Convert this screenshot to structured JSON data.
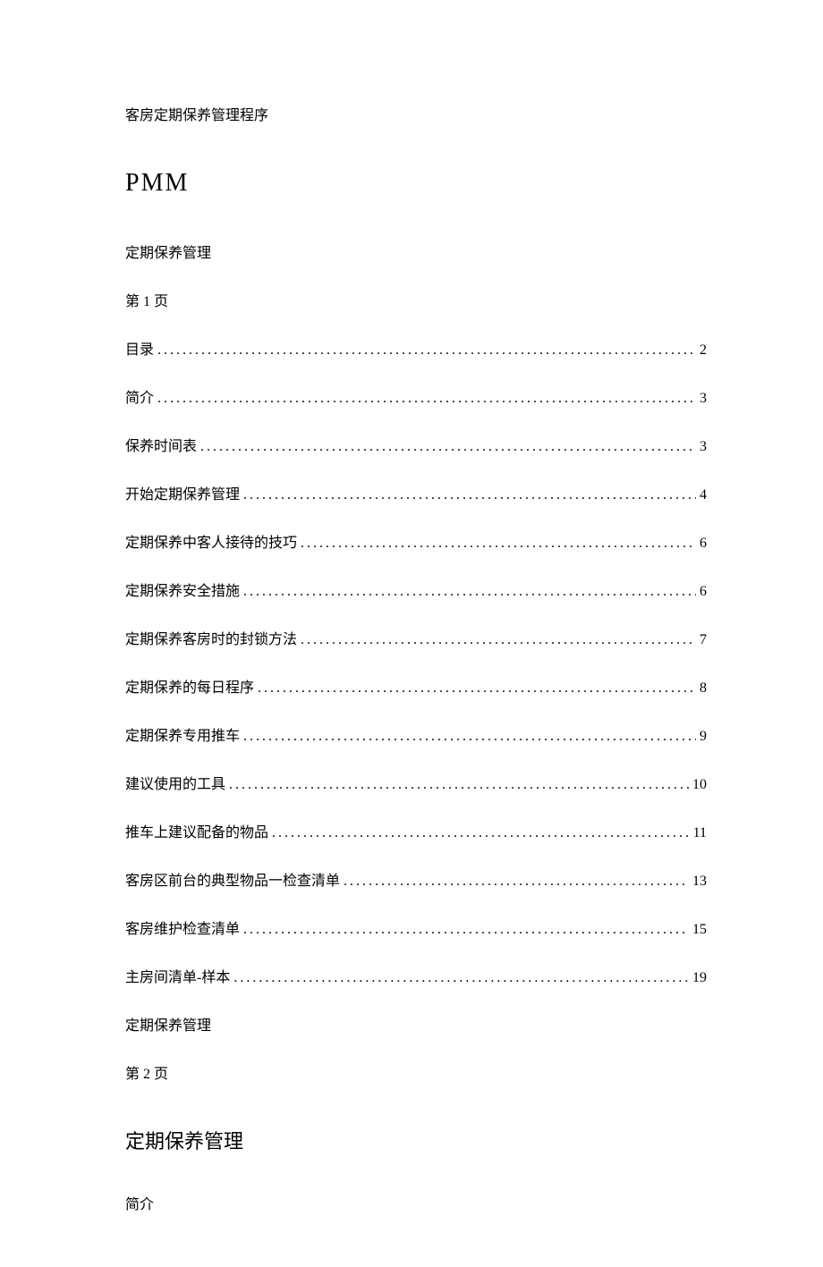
{
  "header": {
    "title": "客房定期保养管理程序"
  },
  "pmm": {
    "label": "PMM"
  },
  "section1": {
    "label": "定期保养管理",
    "pageLabel": "第 1 页"
  },
  "toc": {
    "items": [
      {
        "title": "目录",
        "page": "2"
      },
      {
        "title": "简介",
        "page": "3"
      },
      {
        "title": "保养时间表",
        "page": "3"
      },
      {
        "title": "开始定期保养管理",
        "page": "4"
      },
      {
        "title": "定期保养中客人接待的技巧",
        "page": "6"
      },
      {
        "title": "定期保养安全措施",
        "page": "6"
      },
      {
        "title": "定期保养客房时的封锁方法",
        "page": "7"
      },
      {
        "title": "定期保养的每日程序",
        "page": "8"
      },
      {
        "title": "定期保养专用推车",
        "page": "9"
      },
      {
        "title": "建议使用的工具",
        "page": "10"
      },
      {
        "title": "推车上建议配备的物品",
        "page": "11"
      },
      {
        "title": "客房区前台的典型物品一检查清单",
        "page": "13"
      },
      {
        "title": "客房维护检查清单",
        "page": "15"
      },
      {
        "title": "主房间清单-样本",
        "page": "19"
      }
    ]
  },
  "section2": {
    "label": "定期保养管理",
    "pageLabel": "第 2 页"
  },
  "mainHeading": {
    "text": "定期保养管理"
  },
  "intro": {
    "label": "简介"
  }
}
